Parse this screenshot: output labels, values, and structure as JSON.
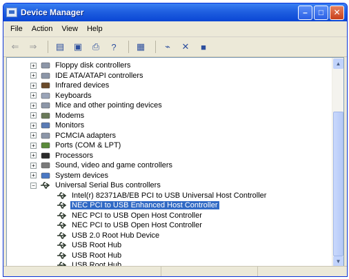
{
  "window": {
    "title": "Device Manager"
  },
  "menu": [
    "File",
    "Action",
    "View",
    "Help"
  ],
  "toolbar": {
    "buttons": [
      {
        "name": "back-icon",
        "glyph": "⇐"
      },
      {
        "name": "forward-icon",
        "glyph": "⇒"
      },
      {
        "name": "show-hide-console-tree-icon",
        "glyph": "▤"
      },
      {
        "name": "properties-icon",
        "glyph": "▣"
      },
      {
        "name": "print-icon",
        "glyph": "⎙"
      },
      {
        "name": "help-icon",
        "glyph": "?"
      },
      {
        "name": "view-devices-icon",
        "glyph": "▦"
      },
      {
        "name": "scan-hardware-icon",
        "glyph": "⌁"
      },
      {
        "name": "uninstall-icon",
        "glyph": "✕"
      },
      {
        "name": "disable-icon",
        "glyph": "■"
      }
    ]
  },
  "tree": [
    {
      "label": "Floppy disk controllers",
      "level": 0,
      "expander": "+",
      "icon": "floppy-controller-icon"
    },
    {
      "label": "IDE ATA/ATAPI controllers",
      "level": 0,
      "expander": "+",
      "icon": "ide-controller-icon"
    },
    {
      "label": "Infrared devices",
      "level": 0,
      "expander": "+",
      "icon": "infrared-icon"
    },
    {
      "label": "Keyboards",
      "level": 0,
      "expander": "+",
      "icon": "keyboard-icon"
    },
    {
      "label": "Mice and other pointing devices",
      "level": 0,
      "expander": "+",
      "icon": "mouse-icon"
    },
    {
      "label": "Modems",
      "level": 0,
      "expander": "+",
      "icon": "modem-icon"
    },
    {
      "label": "Monitors",
      "level": 0,
      "expander": "+",
      "icon": "monitor-icon"
    },
    {
      "label": "PCMCIA adapters",
      "level": 0,
      "expander": "+",
      "icon": "pcmcia-icon"
    },
    {
      "label": "Ports (COM & LPT)",
      "level": 0,
      "expander": "+",
      "icon": "port-icon"
    },
    {
      "label": "Processors",
      "level": 0,
      "expander": "+",
      "icon": "processor-icon"
    },
    {
      "label": "Sound, video and game controllers",
      "level": 0,
      "expander": "+",
      "icon": "sound-icon"
    },
    {
      "label": "System devices",
      "level": 0,
      "expander": "+",
      "icon": "system-devices-icon"
    },
    {
      "label": "Universal Serial Bus controllers",
      "level": 0,
      "expander": "−",
      "icon": "usb-icon"
    },
    {
      "label": "Intel(r) 82371AB/EB PCI to USB Universal Host Controller",
      "level": 1,
      "icon": "usb-icon"
    },
    {
      "label": "NEC PCI to USB Enhanced Host Controller",
      "level": 1,
      "icon": "usb-icon",
      "selected": true
    },
    {
      "label": "NEC PCI to USB Open Host Controller",
      "level": 1,
      "icon": "usb-icon"
    },
    {
      "label": "NEC PCI to USB Open Host Controller",
      "level": 1,
      "icon": "usb-icon"
    },
    {
      "label": "USB 2.0 Root Hub Device",
      "level": 1,
      "icon": "usb-icon"
    },
    {
      "label": "USB Root Hub",
      "level": 1,
      "icon": "usb-icon"
    },
    {
      "label": "USB Root Hub",
      "level": 1,
      "icon": "usb-icon"
    },
    {
      "label": "USB Root Hub",
      "level": 1,
      "icon": "usb-icon"
    }
  ]
}
